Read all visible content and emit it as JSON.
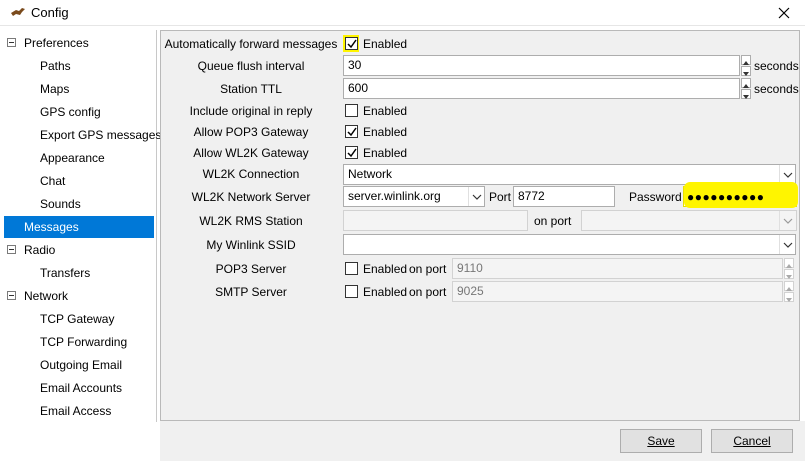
{
  "window": {
    "title": "Config"
  },
  "tree": {
    "items": [
      {
        "label": "Preferences"
      },
      {
        "label": "Paths"
      },
      {
        "label": "Maps"
      },
      {
        "label": "GPS config"
      },
      {
        "label": "Export GPS messages"
      },
      {
        "label": "Appearance"
      },
      {
        "label": "Chat"
      },
      {
        "label": "Sounds"
      },
      {
        "label": "Messages"
      },
      {
        "label": "Radio"
      },
      {
        "label": "Transfers"
      },
      {
        "label": "Network"
      },
      {
        "label": "TCP Gateway"
      },
      {
        "label": "TCP Forwarding"
      },
      {
        "label": "Outgoing Email"
      },
      {
        "label": "Email Accounts"
      },
      {
        "label": "Email Access"
      }
    ],
    "selected": "Messages"
  },
  "form": {
    "auto_forward": {
      "label": "Automatically forward messages",
      "checked": true,
      "option": "Enabled"
    },
    "queue_flush": {
      "label": "Queue flush interval",
      "value": "30",
      "unit": "seconds"
    },
    "station_ttl": {
      "label": "Station TTL",
      "value": "600",
      "unit": "seconds"
    },
    "include_original": {
      "label": "Include original in reply",
      "checked": false,
      "option": "Enabled"
    },
    "allow_pop3": {
      "label": "Allow POP3 Gateway",
      "checked": true,
      "option": "Enabled"
    },
    "allow_wl2k": {
      "label": "Allow WL2K Gateway",
      "checked": true,
      "option": "Enabled"
    },
    "wl2k_connection": {
      "label": "WL2K Connection",
      "value": "Network"
    },
    "wl2k_server": {
      "label": "WL2K Network Server",
      "value": "server.winlink.org",
      "port_label": "Port",
      "port": "8772",
      "password_label": "Password",
      "password": "●●●●●●●●●●"
    },
    "wl2k_rms": {
      "label": "WL2K RMS Station",
      "value": "",
      "on_port_label": "on port",
      "port_value": ""
    },
    "winlink_ssid": {
      "label": "My Winlink SSID",
      "value": ""
    },
    "pop3_server": {
      "label": "POP3 Server",
      "checked": false,
      "option": "Enabled",
      "on_port_label": "on port",
      "port": "9110"
    },
    "smtp_server": {
      "label": "SMTP Server",
      "checked": false,
      "option": "Enabled",
      "on_port_label": "on port",
      "port": "9025"
    }
  },
  "buttons": {
    "save": "Save",
    "cancel": "Cancel"
  },
  "colors": {
    "selection": "#0078d7",
    "highlight": "#fff500",
    "panel": "#f0f0f0"
  }
}
